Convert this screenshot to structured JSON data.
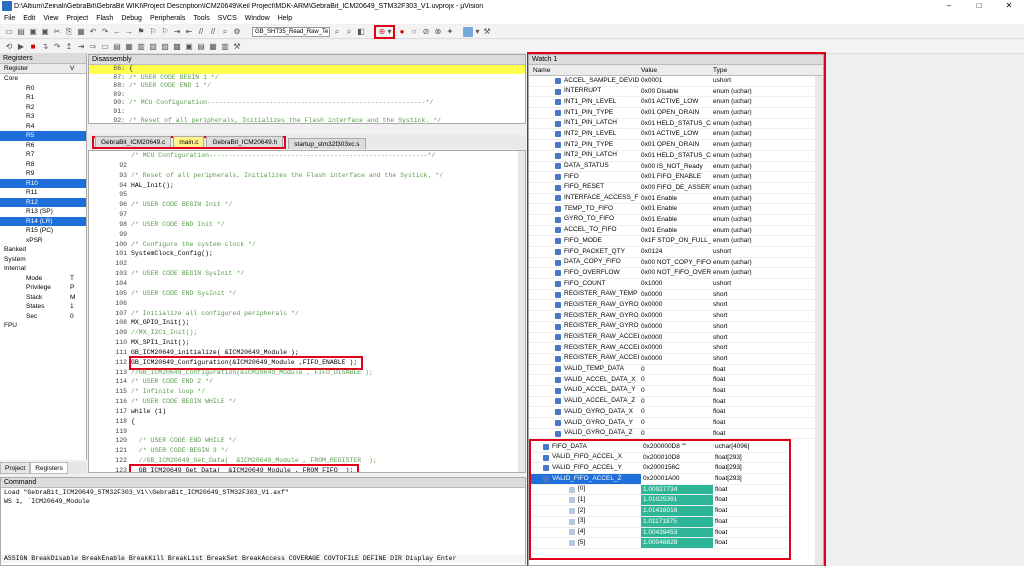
{
  "title": "D:\\Altium\\Zeinali\\GebraBit\\GebraBit WIKI\\Project Description\\ICM20649\\Keil Project\\MDK-ARM\\GebraBit_ICM20649_STM32F303_V1.uvprojx - µVision",
  "menu": [
    "File",
    "Edit",
    "View",
    "Project",
    "Flash",
    "Debug",
    "Peripherals",
    "Tools",
    "SVCS",
    "Window",
    "Help"
  ],
  "toolbar": {
    "target": "GB_SHT35_Read_Raw_Te"
  },
  "registers": {
    "header": "Registers",
    "col1": "Register",
    "col2": "V",
    "rows": [
      {
        "n": "Core",
        "s": false,
        "b": true
      },
      {
        "n": "R0",
        "s": false
      },
      {
        "n": "R1",
        "s": false
      },
      {
        "n": "R2",
        "s": false
      },
      {
        "n": "R3",
        "s": false
      },
      {
        "n": "R4",
        "s": false
      },
      {
        "n": "R5",
        "s": true
      },
      {
        "n": "R6",
        "s": false
      },
      {
        "n": "R7",
        "s": false
      },
      {
        "n": "R8",
        "s": false
      },
      {
        "n": "R9",
        "s": false
      },
      {
        "n": "R10",
        "s": true
      },
      {
        "n": "R11",
        "s": false
      },
      {
        "n": "R12",
        "s": true
      },
      {
        "n": "R13 (SP)",
        "s": false
      },
      {
        "n": "R14 (LR)",
        "s": true
      },
      {
        "n": "R15 (PC)",
        "s": false
      },
      {
        "n": "xPSR",
        "s": false
      },
      {
        "n": "Banked",
        "s": false
      },
      {
        "n": "System",
        "s": false
      },
      {
        "n": "Internal",
        "s": false
      },
      {
        "n": "Mode",
        "s": false,
        "v": "T"
      },
      {
        "n": "Privilege",
        "s": false,
        "v": "P"
      },
      {
        "n": "Stack",
        "s": false,
        "v": "M"
      },
      {
        "n": "States",
        "s": false,
        "v": "1"
      },
      {
        "n": "Sec",
        "s": false,
        "v": "0"
      },
      {
        "n": "FPU",
        "s": false
      }
    ],
    "tabs": [
      "Project",
      "Registers"
    ]
  },
  "disasm": {
    "header": "Disassembly",
    "lines": [
      {
        "ln": "86:",
        "tx": "{",
        "hl": true
      },
      {
        "ln": "87:",
        "tx": "/* USER CODE BEGIN 1 */"
      },
      {
        "ln": "88:",
        "tx": "/* USER CODE END 1 */"
      },
      {
        "ln": "89:",
        "tx": ""
      },
      {
        "ln": "90:",
        "tx": "/* MCU Configuration--------------------------------------------------------*/"
      },
      {
        "ln": "91:",
        "tx": ""
      },
      {
        "ln": "92:",
        "tx": "/* Reset of all peripherals, Initializes the Flash interface and the Systick. */"
      }
    ]
  },
  "tabs": [
    "GebraBit_ICM20649.c",
    "main.c",
    "GebraBit_ICM20649.h",
    "startup_stm32f303xc.s"
  ],
  "editor": [
    {
      "ln": "",
      "tx": "/* MCU Configuration--------------------------------------------------------*/",
      "c": true
    },
    {
      "ln": "92",
      "tx": "",
      "c": true
    },
    {
      "ln": "93",
      "tx": "/* Reset of all peripherals, Initializes the Flash interface and the Systick. */",
      "c": true
    },
    {
      "ln": "94",
      "tx": "HAL_Init();",
      "c": false
    },
    {
      "ln": "95",
      "tx": "",
      "c": false
    },
    {
      "ln": "96",
      "tx": "/* USER CODE BEGIN Init */",
      "c": true
    },
    {
      "ln": "97",
      "tx": "",
      "c": false
    },
    {
      "ln": "98",
      "tx": "/* USER CODE END Init */",
      "c": true
    },
    {
      "ln": "99",
      "tx": "",
      "c": false
    },
    {
      "ln": "100",
      "tx": "/* Configure the system clock */",
      "c": true
    },
    {
      "ln": "101",
      "tx": "SystemClock_Config();",
      "c": false
    },
    {
      "ln": "102",
      "tx": "",
      "c": false
    },
    {
      "ln": "103",
      "tx": "/* USER CODE BEGIN SysInit */",
      "c": true
    },
    {
      "ln": "104",
      "tx": "",
      "c": false
    },
    {
      "ln": "105",
      "tx": "/* USER CODE END SysInit */",
      "c": true
    },
    {
      "ln": "106",
      "tx": "",
      "c": false
    },
    {
      "ln": "107",
      "tx": "/* Initialize all configured peripherals */",
      "c": true
    },
    {
      "ln": "108",
      "tx": "MX_GPIO_Init();",
      "c": false
    },
    {
      "ln": "109",
      "tx": "//MX_I2C1_Init();",
      "c": true
    },
    {
      "ln": "110",
      "tx": "MX_SPI1_Init();",
      "c": false
    },
    {
      "ln": "111",
      "tx": "GB_ICM20649_initialize( &ICM20649_Module );",
      "c": false
    },
    {
      "ln": "112",
      "tx": "GB_ICM20649_Configuration(&ICM20649_Module ,FIFO_ENABLE );",
      "c": false,
      "box": true
    },
    {
      "ln": "113",
      "tx": "//GB_ICM20649_Configuration(&ICM20649_Module , FIFO_DISABLE );",
      "c": true
    },
    {
      "ln": "114",
      "tx": "/* USER CODE END 2 */",
      "c": true
    },
    {
      "ln": "115",
      "tx": "/* Infinite loop */",
      "c": true
    },
    {
      "ln": "116",
      "tx": "/* USER CODE BEGIN WHILE */",
      "c": true
    },
    {
      "ln": "117",
      "tx": "while (1)",
      "c": false
    },
    {
      "ln": "118",
      "tx": "{",
      "c": false
    },
    {
      "ln": "119",
      "tx": "",
      "c": false
    },
    {
      "ln": "120",
      "tx": "  /* USER CODE END WHILE */",
      "c": true
    },
    {
      "ln": "121",
      "tx": "  /* USER CODE BEGIN 3 */",
      "c": true
    },
    {
      "ln": "122",
      "tx": "  //GB_ICM20649_Get_Data(  &ICM20649_Module , FROM_REGISTER  );",
      "c": true
    },
    {
      "ln": "123",
      "tx": "  GB_ICM20649_Get_Data(  &ICM20649_Module , FROM_FIFO  );",
      "c": false,
      "box": true
    },
    {
      "ln": "124",
      "tx": "",
      "c": false
    },
    {
      "ln": "125",
      "tx": "}",
      "c": false
    },
    {
      "ln": "126",
      "tx": "/* USER CODE END 3 */",
      "c": true
    }
  ],
  "command": {
    "header": "Command",
    "lines": [
      "Load \"GebraBit_ICM20649_STM32F303_V1\\\\GebraBit_ICM20649_STM32F303_V1.axf\"",
      "WS 1, `ICM20649_Module"
    ],
    "hint": "ASSIGN BreakDisable BreakEnable BreakKill BreakList BreakSet BreakAccess COVERAGE COVTOFILE DEFINE DIR Display Enter"
  },
  "watch": {
    "header": "Watch 1",
    "cols": [
      "Name",
      "Value",
      "Type"
    ],
    "rows": [
      {
        "n": "ACCEL_SAMPLE_DEVIDE",
        "v": "0x0001",
        "t": "ushort"
      },
      {
        "n": "INTERRUPT",
        "v": "0x00 Disable",
        "t": "enum (uchar)"
      },
      {
        "n": "INT1_PIN_LEVEL",
        "v": "0x01 ACTIVE_LOW",
        "t": "enum (uchar)"
      },
      {
        "n": "INT1_PIN_TYPE",
        "v": "0x01 OPEN_DRAIN",
        "t": "enum (uchar)"
      },
      {
        "n": "INT1_PIN_LATCH",
        "v": "0x01 HELD_STATUS_CL...",
        "t": "enum (uchar)"
      },
      {
        "n": "INT2_PIN_LEVEL",
        "v": "0x01 ACTIVE_LOW",
        "t": "enum (uchar)"
      },
      {
        "n": "INT2_PIN_TYPE",
        "v": "0x01 OPEN_DRAIN",
        "t": "enum (uchar)"
      },
      {
        "n": "INT2_PIN_LATCH",
        "v": "0x01 HELD_STATUS_CL...",
        "t": "enum (uchar)"
      },
      {
        "n": "DATA_STATUS",
        "v": "0x00 IS_NOT_Ready",
        "t": "enum (uchar)"
      },
      {
        "n": "FIFO",
        "v": "0x01 FIFO_ENABLE",
        "t": "enum (uchar)"
      },
      {
        "n": "FIFO_RESET",
        "v": "0x00 FIFO_DE_ASSERT",
        "t": "enum (uchar)"
      },
      {
        "n": "INTERFACE_ACCESS_FIFO",
        "v": "0x01 Enable",
        "t": "enum (uchar)"
      },
      {
        "n": "TEMP_TO_FIFO",
        "v": "0x01 Enable",
        "t": "enum (uchar)"
      },
      {
        "n": "GYRO_TO_FIFO",
        "v": "0x01 Enable",
        "t": "enum (uchar)"
      },
      {
        "n": "ACCEL_TO_FIFO",
        "v": "0x01 Enable",
        "t": "enum (uchar)"
      },
      {
        "n": "FIFO_MODE",
        "v": "0x1F STOP_ON_FULL_...",
        "t": "enum (uchar)"
      },
      {
        "n": "FIFO_PACKET_QTY",
        "v": "0x0124",
        "t": "ushort"
      },
      {
        "n": "DATA_COPY_FIFO",
        "v": "0x00 NOT_COPY_FIFO",
        "t": "enum (uchar)"
      },
      {
        "n": "FIFO_OVERFLOW",
        "v": "0x00 NOT_FIFO_OVER...",
        "t": "enum (uchar)"
      },
      {
        "n": "FIFO_COUNT",
        "v": "0x1000",
        "t": "ushort"
      },
      {
        "n": "REGISTER_RAW_TEMP",
        "v": "0x0000",
        "t": "short"
      },
      {
        "n": "REGISTER_RAW_GYRO_X",
        "v": "0x0000",
        "t": "short"
      },
      {
        "n": "REGISTER_RAW_GYRO_Y",
        "v": "0x0000",
        "t": "short"
      },
      {
        "n": "REGISTER_RAW_GYRO_Z",
        "v": "0x0000",
        "t": "short"
      },
      {
        "n": "REGISTER_RAW_ACCEL_X",
        "v": "0x0000",
        "t": "short"
      },
      {
        "n": "REGISTER_RAW_ACCEL_Y",
        "v": "0x0000",
        "t": "short"
      },
      {
        "n": "REGISTER_RAW_ACCEL_Z",
        "v": "0x0000",
        "t": "short"
      },
      {
        "n": "VALID_TEMP_DATA",
        "v": "0",
        "t": "float"
      },
      {
        "n": "VALID_ACCEL_DATA_X",
        "v": "0",
        "t": "float"
      },
      {
        "n": "VALID_ACCEL_DATA_Y",
        "v": "0",
        "t": "float"
      },
      {
        "n": "VALID_ACCEL_DATA_Z",
        "v": "0",
        "t": "float"
      },
      {
        "n": "VALID_GYRO_DATA_X",
        "v": "0",
        "t": "float"
      },
      {
        "n": "VALID_GYRO_DATA_Y",
        "v": "0",
        "t": "float"
      },
      {
        "n": "VALID_GYRO_DATA_Z",
        "v": "0",
        "t": "float"
      }
    ],
    "fifo_rows": [
      {
        "n": "FIFO_DATA",
        "v": "0x200000D8 \"\"",
        "t": "uchar[4096]"
      },
      {
        "n": "VALID_FIFO_ACCEL_X",
        "v": "0x200010D8",
        "t": "float[293]"
      },
      {
        "n": "VALID_FIFO_ACCEL_Y",
        "v": "0x2000156C",
        "t": "float[293]"
      },
      {
        "n": "VALID_FIFO_ACCEL_Z",
        "v": "0x20001A00",
        "t": "float[293]",
        "sel": true
      },
      {
        "n": "[0]",
        "v": "1.00927734",
        "t": "float",
        "teal": true
      },
      {
        "n": "[1]",
        "v": "1.01025391",
        "t": "float",
        "teal": true
      },
      {
        "n": "[2]",
        "v": "1.01416016",
        "t": "float",
        "teal": true
      },
      {
        "n": "[3]",
        "v": "1.01171875",
        "t": "float",
        "teal": true
      },
      {
        "n": "[4]",
        "v": "1.00439453",
        "t": "float",
        "teal": true
      },
      {
        "n": "[5]",
        "v": "1.00048828",
        "t": "float",
        "teal": true
      }
    ]
  }
}
